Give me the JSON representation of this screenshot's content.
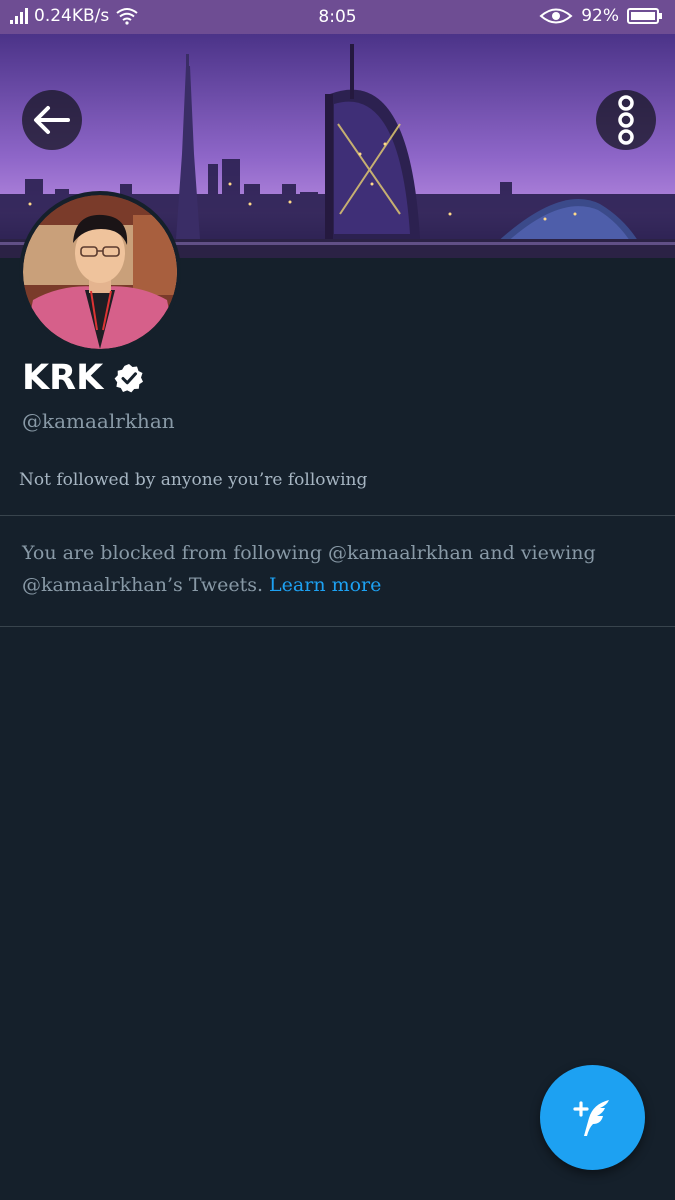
{
  "status_bar": {
    "network_speed": "0.24KB/s",
    "time": "8:05",
    "battery": "92%"
  },
  "profile": {
    "display_name": "KRK",
    "handle": "@kamaalrkhan",
    "verified": true,
    "follow_note": "Not followed by anyone you’re following"
  },
  "blocked": {
    "message": "You are blocked from following @kamaalrkhan and viewing @kamaalrkhan’s Tweets.",
    "link": "Learn more"
  },
  "icons": {
    "back": "back-arrow-icon",
    "more": "more-options-icon",
    "compose": "compose-tweet-icon",
    "verified": "verified-badge-icon"
  },
  "colors": {
    "background": "#15202b",
    "accent": "#1da1f2",
    "status_bar": "#6e4d93",
    "secondary_text": "#8899a6"
  }
}
